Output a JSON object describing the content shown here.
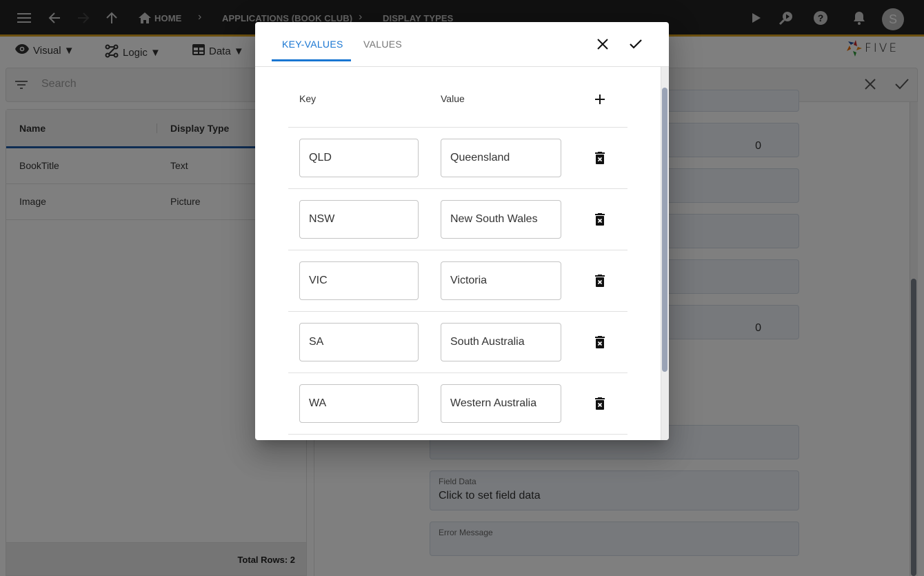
{
  "appbar": {
    "breadcrumbs": [
      "HOME",
      "APPLICATIONS (BOOK CLUB)",
      "DISPLAY TYPES"
    ],
    "avatar_initial": "S",
    "accent_color": "#d8a120"
  },
  "toolbar": {
    "items": [
      {
        "label": "Visual ▼",
        "icon": "eye-icon"
      },
      {
        "label": "Logic ▼",
        "icon": "flow-icon"
      },
      {
        "label": "Data ▼",
        "icon": "table-icon"
      }
    ],
    "logo_text": "FIVE"
  },
  "list": {
    "search_placeholder": "Search",
    "columns": [
      "Name",
      "Display Type"
    ],
    "rows": [
      {
        "name": "BookTitle",
        "display_type": "Text"
      },
      {
        "name": "Image",
        "display_type": "Picture"
      }
    ],
    "total_rows_label": "Total Rows: 2"
  },
  "form": {
    "numeric_values": [
      "0",
      "0"
    ],
    "fields": [
      {
        "label": "Field Data",
        "value": "Click to set field data"
      },
      {
        "label": "Error Message",
        "value": ""
      }
    ]
  },
  "dialog": {
    "tabs": [
      {
        "label": "KEY-VALUES",
        "active": true
      },
      {
        "label": "VALUES",
        "active": false
      }
    ],
    "columns": {
      "key": "Key",
      "value": "Value"
    },
    "rows": [
      {
        "key": "QLD",
        "value": "Queensland"
      },
      {
        "key": "NSW",
        "value": "New South Wales"
      },
      {
        "key": "VIC",
        "value": "Victoria"
      },
      {
        "key": "SA",
        "value": "South Australia"
      },
      {
        "key": "WA",
        "value": "Western Australia"
      }
    ],
    "accent_color": "#1976d2"
  }
}
